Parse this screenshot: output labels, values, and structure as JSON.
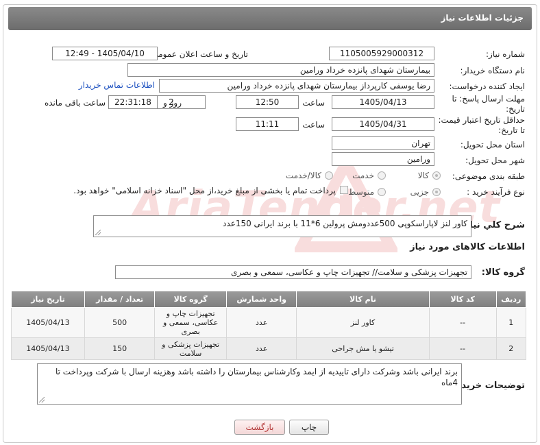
{
  "header": {
    "title": "جزئیات اطلاعات نیاز"
  },
  "fields": {
    "need_number_label": "شماره نیاز:",
    "need_number": "1105005929000312",
    "announce_label": "تاریخ و ساعت اعلان عمومی:",
    "announce_value": "1405/04/10 - 12:49",
    "buyer_org_label": "نام دستگاه خریدار:",
    "buyer_org": "بیمارستان شهدای پانزده خرداد ورامین",
    "creator_label": "ایجاد کننده درخواست:",
    "creator": "رضا یوسفی کارپرداز بیمارستان شهدای پانزده خرداد ورامین",
    "buyer_contact_link": "اطلاعات تماس خریدار",
    "deadline_label": "مهلت ارسال پاسخ: تا تاریخ:",
    "deadline_date": "1405/04/13",
    "time_label": "ساعت",
    "deadline_time": "12:50",
    "days_value": "2",
    "days_label": "روز و",
    "remaining_time": "22:31:18",
    "remaining_label": "ساعت باقی مانده",
    "validity_label": "حداقل تاریخ اعتبار قیمت: تا تاریخ:",
    "validity_date": "1405/04/31",
    "validity_time": "11:11",
    "province_label": "استان محل تحویل:",
    "province": "تهران",
    "city_label": "شهر محل تحویل:",
    "city": "ورامین",
    "category_label": "طبقه بندی موضوعی:",
    "category_options": [
      "کالا",
      "خدمت",
      "کالا/خدمت"
    ],
    "process_label": "نوع فرآیند خرید :",
    "process_options": [
      "جزیی",
      "متوسط"
    ],
    "payment_note": "پرداخت تمام یا بخشی از مبلغ خرید،از محل \"اسناد خزانه اسلامی\" خواهد بود."
  },
  "description": {
    "label": "شرح كلي نياز:",
    "text": "کاور لنز لاپاراسکوپی 500عددومش پرولین 6*11 با برند ایرانی 150عدد"
  },
  "goods": {
    "section_title": "اطلاعات کالاهای مورد نیاز",
    "group_label": "گروه کالا:",
    "group_value": "تجهیزات پزشکی و سلامت// تجهیزات چاپ و عکاسی، سمعی و بصری",
    "columns": [
      "ردیف",
      "کد کالا",
      "نام کالا",
      "واحد شمارش",
      "گروه کالا",
      "تعداد / مقدار",
      "تاریخ نیاز"
    ],
    "rows": [
      [
        "1",
        "--",
        "کاور لنز",
        "عدد",
        "تجهیزات چاپ و عکاسی، سمعی و بصری",
        "500",
        "1405/04/13"
      ],
      [
        "2",
        "--",
        "تیشو یا مش جراحی",
        "عدد",
        "تجهیزات پزشکی و سلامت",
        "150",
        "1405/04/13"
      ]
    ]
  },
  "buyer_notes": {
    "label": "توضیحات خریدار:",
    "text": "برند ایرانی باشد وشرکت دارای تاییدیه از ایمد وکارشناس بیمارستان را داشته باشد وهزینه ارسال با شرکت وپرداخت تا 4ماه"
  },
  "buttons": {
    "print": "چاپ",
    "back": "بازگشت"
  },
  "watermark": {
    "text": "AriaTender.net"
  },
  "colors": {
    "header_bg": "#7a7a7a",
    "link": "#1a4fbf",
    "back_button_text": "#b43a3a"
  }
}
